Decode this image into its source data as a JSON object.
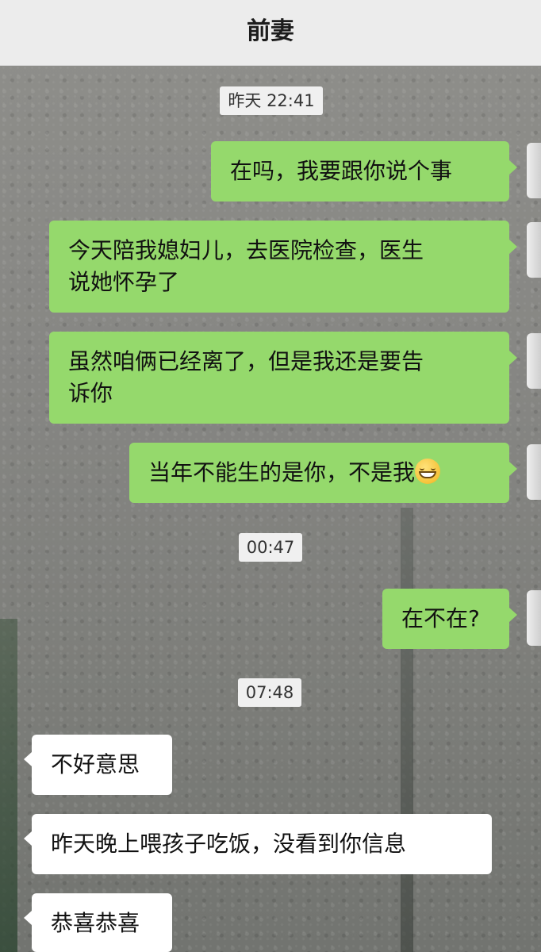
{
  "header": {
    "title": "前妻"
  },
  "timestamps": {
    "t1": "昨天 22:41",
    "t2": "00:47",
    "t3": "07:48"
  },
  "messages": {
    "m1": "在吗，我要跟你说个事",
    "m2_line1": "今天陪我媳妇儿，去医院检查，医生",
    "m2_line2": "说她怀孕了",
    "m3_line1": "虽然咱俩已经离了，但是我还是要告",
    "m3_line2": "诉你",
    "m4": "当年不能生的是你，不是我",
    "m4_emoji": "grinning-face-emoji",
    "m5": "在不在?",
    "r1": "不好意思",
    "r2": "昨天晚上喂孩子吃饭，没看到你信息",
    "r3": "恭喜恭喜"
  },
  "colors": {
    "sent_bubble": "#95d96c",
    "received_bubble": "#ffffff",
    "header_bg": "#ececec"
  }
}
